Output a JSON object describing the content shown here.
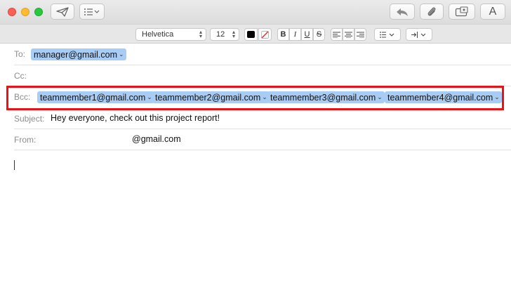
{
  "window": {
    "traffic_lights": {
      "close": "#fd5f57",
      "minimize": "#febc2e",
      "maximize": "#28c840"
    }
  },
  "toolbar": {
    "send_icon": "paper-plane-icon",
    "header_fields_icon": "list-icon",
    "reply_icon": "reply-arrow-icon",
    "attach_icon": "paperclip-icon",
    "photo_browser_icon": "photo-icon",
    "format_label": "A"
  },
  "formatbar": {
    "font_family": "Helvetica",
    "font_size": "12",
    "text_color": "#000000",
    "bold_label": "B",
    "italic_label": "I",
    "underline_label": "U",
    "strikethrough_label": "S"
  },
  "fields": {
    "to": {
      "label": "To:",
      "recipients": [
        "manager@gmail.com"
      ]
    },
    "cc": {
      "label": "Cc:",
      "recipients": []
    },
    "bcc": {
      "label": "Bcc:",
      "recipients": [
        "teammember1@gmail.com",
        "teammember2@gmail.com",
        "teammember3@gmail.com",
        "teammember4@gmail.com"
      ]
    },
    "subject": {
      "label": "Subject:",
      "value": "Hey everyone, check out this project report!"
    },
    "from": {
      "label": "From:",
      "value": "@gmail.com"
    }
  },
  "colors": {
    "token_bg": "#a9ccf5",
    "highlight": "#ea1212"
  }
}
